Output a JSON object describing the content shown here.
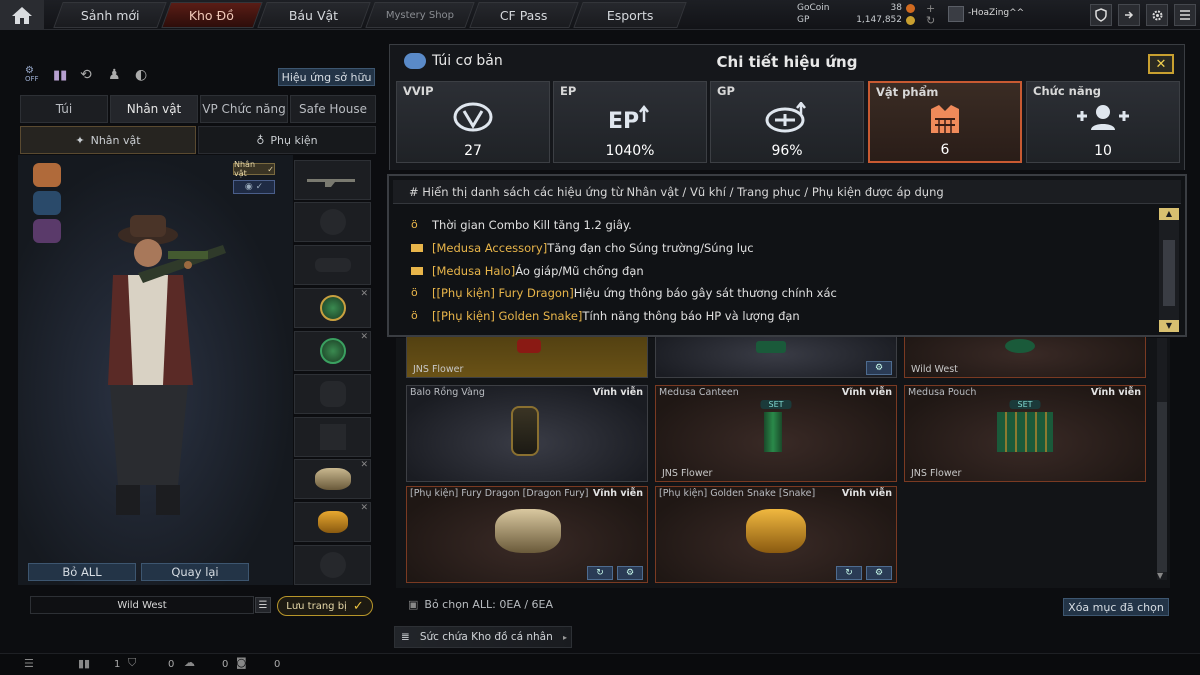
{
  "nav": {
    "tabs": [
      "Sảnh mới",
      "Kho Đồ",
      "Báu Vật",
      "Mystery Shop",
      "CF Pass",
      "Esports"
    ],
    "currency": {
      "gocoin_label": "GoCoin",
      "gocoin_value": "38",
      "gp_label": "GP",
      "gp_value": "1,147,852"
    },
    "username": "-HoaZing^^"
  },
  "left": {
    "top_icon_off": "OFF",
    "owned_effects_btn": "Hiệu ứng sở hữu",
    "tabs": [
      "Túi",
      "Nhân vật",
      "VP Chức năng",
      "Safe House"
    ],
    "subtabs": [
      "Nhân vật",
      "Phụ kiện"
    ],
    "badge": "Nhân vật",
    "btn_remove_all": "Bỏ ALL",
    "btn_back": "Quay lại",
    "preset_name": "Wild West",
    "save_btn": "Lưu trang bị"
  },
  "popup": {
    "left_title": "Túi cơ bản",
    "title": "Chi tiết hiệu ứng",
    "stats": [
      {
        "label": "VVIP",
        "value": "27",
        "icon": "vvip-icon"
      },
      {
        "label": "EP",
        "value": "1040%",
        "icon": "ep-icon"
      },
      {
        "label": "GP",
        "value": "96%",
        "icon": "gp-icon"
      },
      {
        "label": "Vật phẩm",
        "value": "6",
        "icon": "vest-icon"
      },
      {
        "label": "Chức năng",
        "value": "10",
        "icon": "team-add-icon"
      }
    ],
    "effects_header": "# Hiển thị danh sách các hiệu ứng từ Nhân vật / Vũ khí / Trang phục / Phụ kiện được áp dụng",
    "effects": [
      {
        "tag": "",
        "text": "Thời gian Combo Kill tăng 1.2 giây.",
        "icon": "medal-icon"
      },
      {
        "tag": "[Medusa Accessory]",
        "text": "Tăng đạn cho Súng trường/Súng lục",
        "icon": "vest-icon"
      },
      {
        "tag": "[Medusa Halo]",
        "text": "Áo giáp/Mũ chống đạn",
        "icon": "vest-icon"
      },
      {
        "tag": "[[Phụ kiện] Fury Dragon]",
        "text": "Hiệu ứng thông báo gây sát thương chính xác",
        "icon": "medal-icon"
      },
      {
        "tag": "[[Phụ kiện] Golden Snake]",
        "text": "Tính năng thông báo HP và lượng đạn",
        "icon": "medal-icon"
      }
    ]
  },
  "cards": [
    {
      "name": "",
      "perm": "",
      "footer": "JNS Flower",
      "set": ""
    },
    {
      "name": "",
      "perm": "",
      "footer": "",
      "set": ""
    },
    {
      "name": "",
      "perm": "",
      "footer": "Wild West",
      "set": ""
    },
    {
      "name": "Balo Rồng Vàng",
      "perm": "Vĩnh viễn",
      "footer": "",
      "set": ""
    },
    {
      "name": "Medusa Canteen",
      "perm": "Vĩnh viễn",
      "footer": "JNS Flower",
      "set": "SET"
    },
    {
      "name": "Medusa Pouch",
      "perm": "Vĩnh viễn",
      "footer": "JNS Flower",
      "set": "SET"
    },
    {
      "name": "[Phụ kiện] Fury Dragon [Dragon Fury]",
      "perm": "Vĩnh viễn",
      "footer": "",
      "set": ""
    },
    {
      "name": "[Phụ kiện] Golden Snake [Snake]",
      "perm": "Vĩnh viễn",
      "footer": "",
      "set": ""
    }
  ],
  "bottom": {
    "select_all": "Bỏ chọn ALL: 0EA / 6EA",
    "delete_selected": "Xóa mục đã chọn",
    "capacity": "Sức chứa Kho đồ cá nhân",
    "status": [
      "1",
      "0",
      "0",
      "0"
    ]
  },
  "colors": {
    "accent": "#c85a32",
    "tag": "#e8b54a",
    "button_blue": "#233447"
  }
}
